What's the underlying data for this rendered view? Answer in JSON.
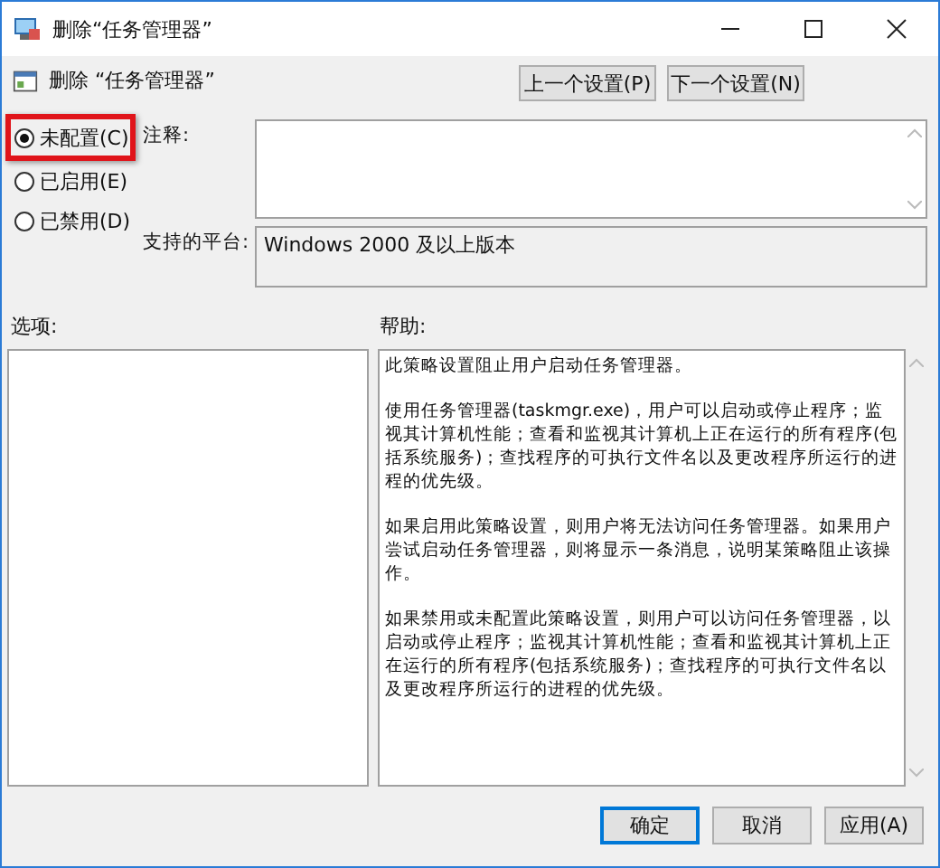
{
  "window": {
    "title": "删除“任务管理器”"
  },
  "header": {
    "title": "删除 “任务管理器”"
  },
  "nav_buttons": [
    {
      "label": "上一个设置(P)"
    },
    {
      "label": "下一个设置(N)"
    }
  ],
  "state_options": [
    {
      "label": "未配置(C)",
      "selected": true,
      "highlighted": true
    },
    {
      "label": "已启用(E)",
      "selected": false,
      "highlighted": false
    },
    {
      "label": "已禁用(D)",
      "selected": false,
      "highlighted": false
    }
  ],
  "comment": {
    "label": "注释:"
  },
  "platform": {
    "label": "支持的平台:",
    "value": "Windows 2000 及以上版本"
  },
  "options": {
    "label": "选项:"
  },
  "help": {
    "label": "帮助:",
    "paragraphs": [
      "此策略设置阻止用户启动任务管理器。",
      "使用任务管理器(taskmgr.exe)，用户可以启动或停止程序；监视其计算机性能；查看和监视其计算机上正在运行的所有程序(包括系统服务)；查找程序的可执行文件名以及更改程序所运行的进程的优先级。",
      "如果启用此策略设置，则用户将无法访问任务管理器。如果用户尝试启动任务管理器，则将显示一条消息，说明某策略阻止该操作。",
      "如果禁用或未配置此策略设置，则用户可以访问任务管理器，以启动或停止程序；监视其计算机性能；查看和监视其计算机上正在运行的所有程序(包括系统服务)；查找程序的可执行文件名以及更改程序所运行的进程的优先级。"
    ]
  },
  "footer_buttons": [
    {
      "label": "确定",
      "focused": true
    },
    {
      "label": "取消",
      "focused": false
    },
    {
      "label": "应用(A)",
      "focused": false
    }
  ]
}
